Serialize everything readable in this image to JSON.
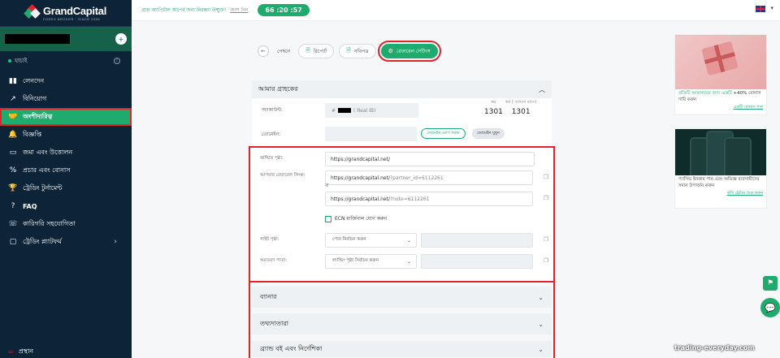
{
  "brand": {
    "name": "GrandCapital",
    "tagline": "FOREX BROKER · SINCE 2006"
  },
  "user": {
    "verify_label": "যাচাই"
  },
  "sidebar": {
    "items": [
      {
        "label": "লেনদেন",
        "icon": "chart-bars-icon"
      },
      {
        "label": "বিনিয়োগ",
        "icon": "trend-up-icon"
      },
      {
        "label": "অংশীদারিত্ব",
        "icon": "handshake-icon"
      },
      {
        "label": "বিজ্ঞপ্তি",
        "icon": "bell-icon"
      },
      {
        "label": "জমা এবং উত্তোলন",
        "icon": "wallet-icon"
      },
      {
        "label": "প্রচার এবং বোনাস",
        "icon": "percent-icon"
      },
      {
        "label": "ট্রেডিং টুর্নামেন্ট",
        "icon": "trophy-icon"
      },
      {
        "label": "FAQ",
        "icon": "question-icon"
      },
      {
        "label": "কারিগরি সহযোগিতা",
        "icon": "headset-icon"
      },
      {
        "label": "ট্রেডিং প্ল্যাটফর্ম",
        "icon": "monitor-icon"
      }
    ],
    "logout_label": "প্রস্থান"
  },
  "topbar": {
    "message": "গ্রান্ড ক্যাপিটাল কাপের জন্য নিবন্ধন উন্মুক্ত!",
    "message_link": "অংশ নিন",
    "timer": "66 :20 :57"
  },
  "tabs": {
    "back": "পেছনে",
    "reports": "রিপোর্ট",
    "docs": "নথিপত্র",
    "referral": "রেফারেল সেটিংস"
  },
  "clients_panel": {
    "title": "আমার গ্রাহকের",
    "account_label": "অ্যাকাউন্ট:",
    "account_prefix": "#",
    "account_type": "( Real IB)",
    "level_label": "স্তর",
    "level_value": "1301",
    "level2_label": "স্তর ( বর্তমান মাসে)",
    "level2_value": "1301",
    "domain_label": "ডোমেইন:",
    "domain_add": "ডোমেইন যোগ করুন",
    "domain_remove": "ডোমেইন মুছুন"
  },
  "links": {
    "landing_label": "কাঙ্খিত পৃষ্ঠা:",
    "landing_value": "https://grandcapital.net/",
    "ref_label": "আপনার রেফারেল লিংক:",
    "ref_url_base": "https://grandcapital.net/",
    "ref_url_param": "?partner_id=6112261",
    "or_label": "বা",
    "note_base": "https://grandcapital.net/",
    "note_param": "?note=6112261",
    "ecn_label": "ECN মার্জিনাল যোগ করুন",
    "site_label": "সাইট পৃষ্ঠা:",
    "site_placeholder": "পেজ নির্বাচন করুন",
    "landing2_label": "অবতরণ পাতা:",
    "landing2_placeholder": "ল্যান্ডিং পৃষ্ঠা নির্বাচন করুন"
  },
  "accordions": [
    {
      "title": "ব্যানার"
    },
    {
      "title": "তথ্যদাতারা"
    },
    {
      "title": "ব্র্যান্ড বই এবং নির্দেশিকা"
    }
  ],
  "promos": [
    {
      "text_green": "প্রতিটি আমানতের জন্য একটি",
      "text": "+40% বোনাস দাবি করুন",
      "link": "একটি বোনাস পান"
    },
    {
      "text": "প্যাসিভ ইনকাম পান এবং অভিজ্ঞ ব্যবসায়ীদের সমান উপার্জন করুন",
      "link": "কপি ট্রেডিং শুরু করুন"
    }
  ],
  "watermark": "trading-everyday.com",
  "colors": {
    "sidebar_bg": "#0d2438",
    "accent": "#1faa6e",
    "highlight": "#e0242b"
  }
}
